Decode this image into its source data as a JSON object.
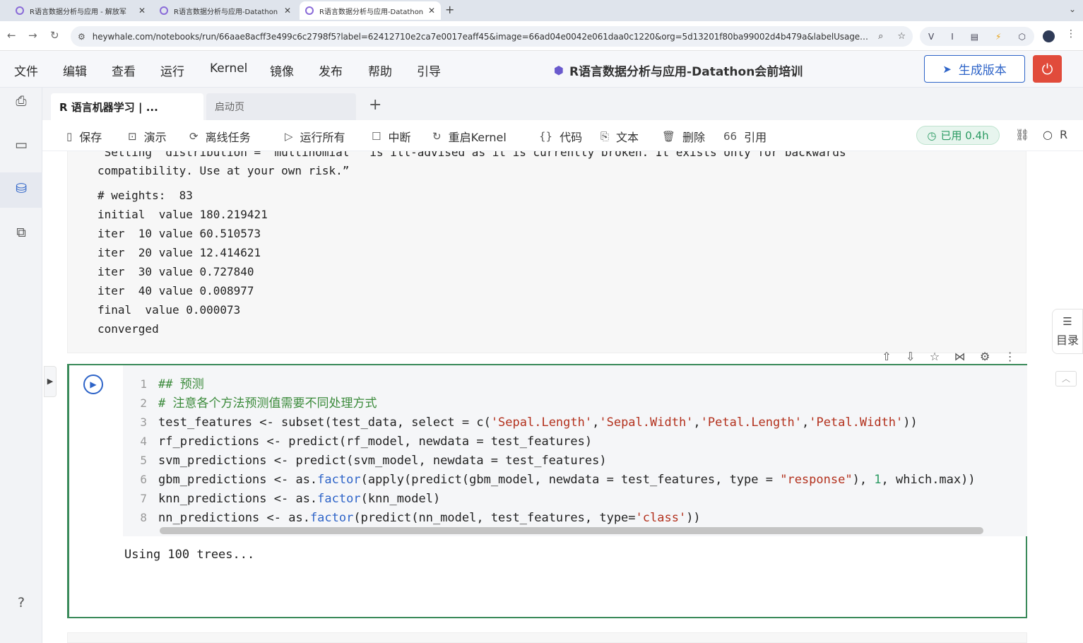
{
  "browser": {
    "tabs": [
      {
        "title": "R语言数据分析与应用 - 解放军",
        "active": false
      },
      {
        "title": "R语言数据分析与应用-Datathon",
        "active": false
      },
      {
        "title": "R语言数据分析与应用-Datathon",
        "active": true
      }
    ],
    "url": "heywhale.com/notebooks/run/66aae8acff3e499c6c2798f5?label=62412710e2ca7e0017eaff45&image=66ad04e0042e061daa0c1220&org=5d13201f80ba99002d4b479a&labelUsageType=O..."
  },
  "menubar": {
    "items": [
      "文件",
      "编辑",
      "查看",
      "运行",
      "Kernel",
      "镜像",
      "发布",
      "帮助",
      "引导"
    ],
    "title": "R语言数据分析与应用-Datathon会前培训",
    "generate_version": "生成版本"
  },
  "notebook_tabs": {
    "active": "R 语言机器学习 | ...",
    "inactive": "启动页"
  },
  "toolbar": {
    "save": "保存",
    "present": "演示",
    "offline": "离线任务",
    "run_all": "运行所有",
    "interrupt": "中断",
    "restart": "重启Kernel",
    "code": "代码",
    "text": "文本",
    "delete": "删除",
    "cite": "引用",
    "usage": "已用 0.4h",
    "kernel_label": "R"
  },
  "prev_output": {
    "lines": [
      "\"Setting `distribution = \"multinomial\"` is ill-advised as it is currently broken. It exists only for backwards",
      "compatibility. Use at your own risk.”",
      "# weights:  83",
      "initial  value 180.219421",
      "iter  10 value 60.510573",
      "iter  20 value 12.414621",
      "iter  30 value 0.727840",
      "iter  40 value 0.008977",
      "final  value 0.000073",
      "converged"
    ]
  },
  "toc": {
    "label": "目录"
  },
  "cell": {
    "line_numbers": [
      "1",
      "2",
      "3",
      "4",
      "5",
      "6",
      "7",
      "8"
    ],
    "output": "Using 100 trees..."
  }
}
